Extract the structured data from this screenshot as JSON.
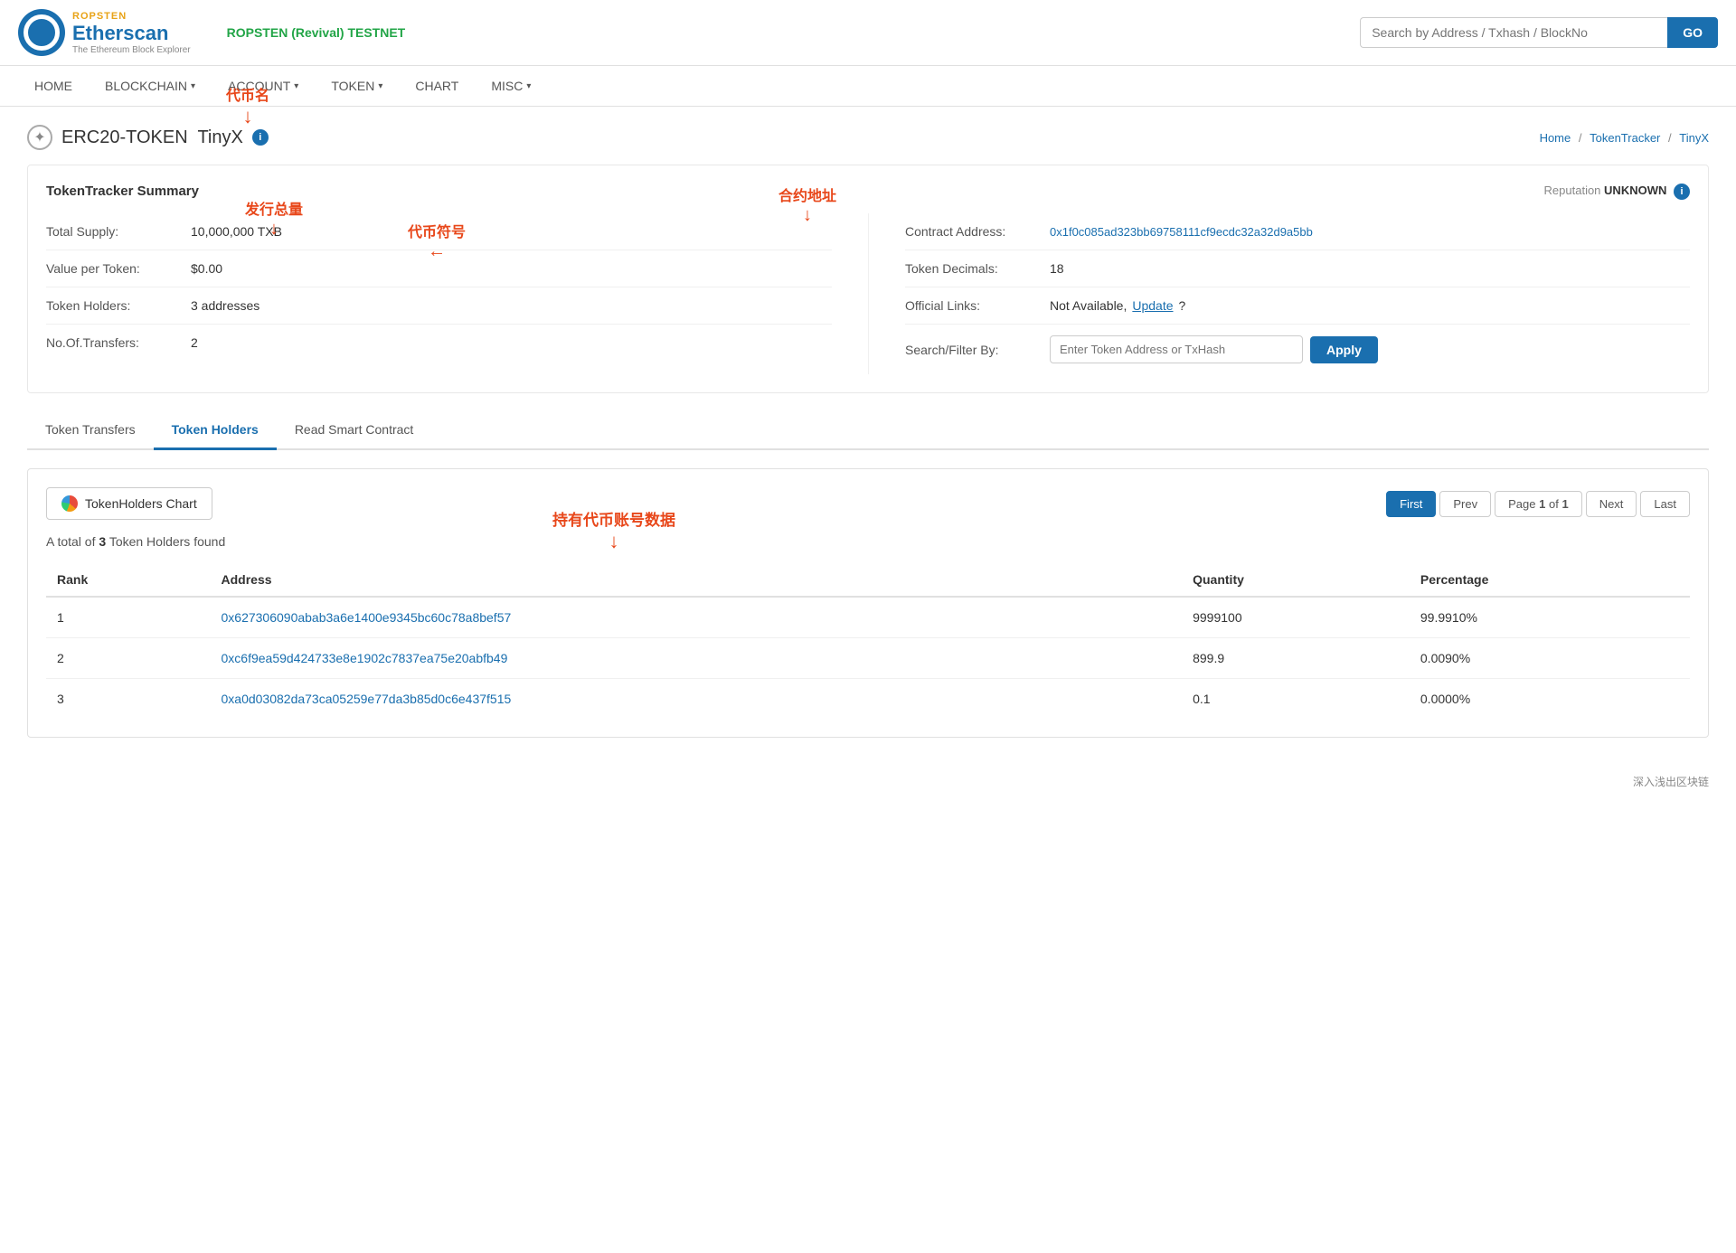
{
  "header": {
    "logo": {
      "ropsten_label": "ROPSTEN",
      "brand": "Etherscan",
      "sub": "The Ethereum Block Explorer"
    },
    "network": "ROPSTEN (Revival) TESTNET",
    "search": {
      "placeholder": "Search by Address / Txhash / BlockNo",
      "go_label": "GO"
    },
    "nav": [
      {
        "id": "home",
        "label": "HOME",
        "has_dropdown": false
      },
      {
        "id": "blockchain",
        "label": "BLOCKCHAIN",
        "has_dropdown": true
      },
      {
        "id": "account",
        "label": "ACCOUNT",
        "has_dropdown": true
      },
      {
        "id": "token",
        "label": "TOKEN",
        "has_dropdown": true
      },
      {
        "id": "chart",
        "label": "CHART",
        "has_dropdown": false
      },
      {
        "id": "misc",
        "label": "MISC",
        "has_dropdown": true
      }
    ]
  },
  "breadcrumb": {
    "home_label": "Home",
    "token_tracker_label": "TokenTracker",
    "current_label": "TinyX"
  },
  "page": {
    "token_type": "ERC20-TOKEN",
    "token_name": "TinyX",
    "title_annotation": "代币名"
  },
  "summary": {
    "section_title": "TokenTracker Summary",
    "reputation_label": "Reputation",
    "reputation_value": "UNKNOWN",
    "rows_left": [
      {
        "label": "Total Supply:",
        "value": "10,000,000 TXB",
        "is_link": false
      },
      {
        "label": "Value per Token:",
        "value": "$0.00",
        "is_link": false
      },
      {
        "label": "Token Holders:",
        "value": "3 addresses",
        "is_link": false
      },
      {
        "label": "No.Of.Transfers:",
        "value": "2",
        "is_link": false
      }
    ],
    "rows_right": [
      {
        "label": "Contract Address:",
        "value": "0x1f0c085ad323bb69758111cf9ecdc32a32d9a5bb",
        "is_link": true
      },
      {
        "label": "Token Decimals:",
        "value": "18",
        "is_link": false
      },
      {
        "label": "Official Links:",
        "value_text": "Not Available,",
        "value_link": "Update",
        "value_suffix": "?",
        "is_special": true
      },
      {
        "label": "Search/Filter By:",
        "is_filter": true,
        "placeholder": "Enter Token Address or TxHash",
        "apply_label": "Apply"
      }
    ],
    "annotations": {
      "total_supply": "发行总量",
      "token_symbol": "代币符号",
      "contract_address": "合约地址"
    }
  },
  "tabs": [
    {
      "id": "transfers",
      "label": "Token Transfers",
      "active": false
    },
    {
      "id": "holders",
      "label": "Token Holders",
      "active": true
    },
    {
      "id": "contract",
      "label": "Read Smart Contract",
      "active": false
    }
  ],
  "holders": {
    "chart_btn_label": "TokenHolders Chart",
    "count_text": "A total of",
    "count": "3",
    "count_suffix": "Token Holders found",
    "annotation": "持有代币账号数据",
    "pagination": {
      "first_label": "First",
      "prev_label": "Prev",
      "page_label": "Page",
      "bold": "1",
      "of_label": "of",
      "page_total": "1",
      "next_label": "Next",
      "last_label": "Last"
    },
    "columns": [
      {
        "id": "rank",
        "label": "Rank"
      },
      {
        "id": "address",
        "label": "Address"
      },
      {
        "id": "quantity",
        "label": "Quantity"
      },
      {
        "id": "percentage",
        "label": "Percentage"
      }
    ],
    "rows": [
      {
        "rank": "1",
        "address": "0x627306090abab3a6e1400e9345bc60c78a8bef57",
        "quantity": "9999100",
        "percentage": "99.9910%"
      },
      {
        "rank": "2",
        "address": "0xc6f9ea59d424733e8e1902c7837ea75e20abfb49",
        "quantity": "899.9",
        "percentage": "0.0090%"
      },
      {
        "rank": "3",
        "address": "0xa0d03082da73ca05259e77da3b85d0c6e437f515",
        "quantity": "0.1",
        "percentage": "0.0000%"
      }
    ]
  },
  "footer": {
    "label": "深入浅出区块链"
  }
}
